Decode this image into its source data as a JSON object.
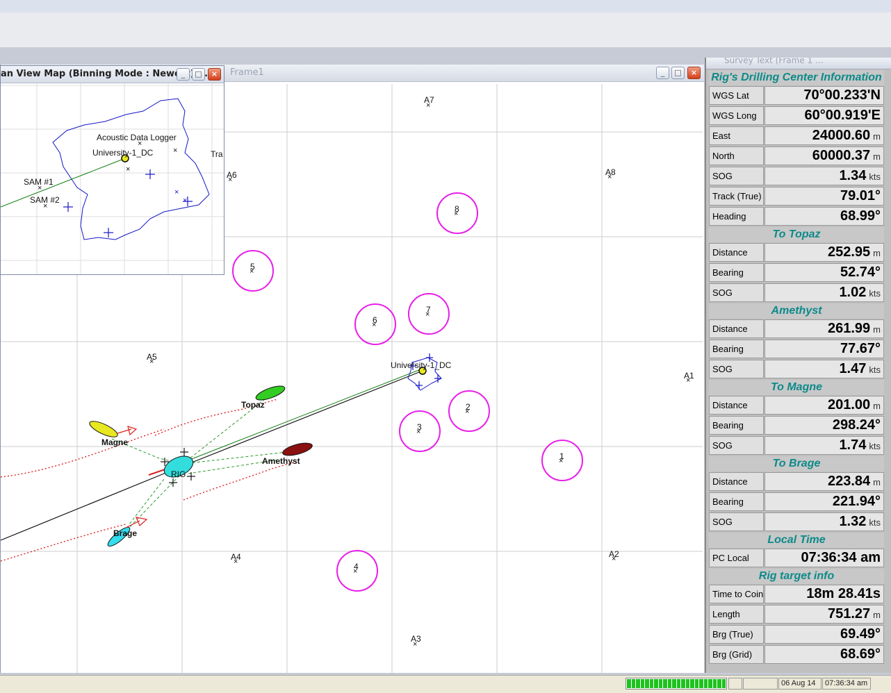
{
  "inset_window": {
    "title": "an View Map (Binning Mode : Newest) ...",
    "labels": {
      "adl": "Acoustic Data Logger",
      "univ": "University-1_DC",
      "sam1": "SAM #1",
      "sam2": "SAM #2",
      "tra": "Tra"
    }
  },
  "main_window": {
    "title": "Frame1"
  },
  "panel": {
    "title": "Survey Text (Frame 1 ...",
    "sections": [
      {
        "title": "Rig's Drilling Center Information",
        "rows": [
          {
            "label": "WGS Lat",
            "value": "70°00.233'N",
            "unit": ""
          },
          {
            "label": "WGS Long",
            "value": "60°00.919'E",
            "unit": ""
          },
          {
            "label": "East",
            "value": "24000.60",
            "unit": "m"
          },
          {
            "label": "North",
            "value": "60000.37",
            "unit": "m"
          },
          {
            "label": "SOG",
            "value": "1.34",
            "unit": "kts"
          },
          {
            "label": "Track (True)",
            "value": "79.01°",
            "unit": ""
          },
          {
            "label": "Heading",
            "value": "68.99°",
            "unit": ""
          }
        ]
      },
      {
        "title": "To Topaz",
        "rows": [
          {
            "label": "Distance",
            "value": "252.95",
            "unit": "m"
          },
          {
            "label": "Bearing",
            "value": "52.74°",
            "unit": ""
          },
          {
            "label": "SOG",
            "value": "1.02",
            "unit": "kts"
          }
        ]
      },
      {
        "title": "Amethyst",
        "rows": [
          {
            "label": "Distance",
            "value": "261.99",
            "unit": "m"
          },
          {
            "label": "Bearing",
            "value": "77.67°",
            "unit": ""
          },
          {
            "label": "SOG",
            "value": "1.47",
            "unit": "kts"
          }
        ]
      },
      {
        "title": "To Magne",
        "rows": [
          {
            "label": "Distance",
            "value": "201.00",
            "unit": "m"
          },
          {
            "label": "Bearing",
            "value": "298.24°",
            "unit": ""
          },
          {
            "label": "SOG",
            "value": "1.74",
            "unit": "kts"
          }
        ]
      },
      {
        "title": "To Brage",
        "rows": [
          {
            "label": "Distance",
            "value": "223.84",
            "unit": "m"
          },
          {
            "label": "Bearing",
            "value": "221.94°",
            "unit": ""
          },
          {
            "label": "SOG",
            "value": "1.32",
            "unit": "kts"
          }
        ]
      },
      {
        "title": "Local Time",
        "rows": [
          {
            "label": "PC Local",
            "value": "07:36:34 am",
            "unit": ""
          }
        ]
      },
      {
        "title": "Rig target info",
        "rows": [
          {
            "label": "Time to Coin",
            "value": "18m 28.41s",
            "unit": ""
          },
          {
            "label": "Length",
            "value": "751.27",
            "unit": "m"
          },
          {
            "label": "Brg (True)",
            "value": "69.49°",
            "unit": ""
          },
          {
            "label": "Brg (Grid)",
            "value": "68.69°",
            "unit": ""
          }
        ]
      }
    ]
  },
  "map": {
    "anchors": [
      "A1",
      "A2",
      "A3",
      "A4",
      "A5",
      "A6",
      "A7",
      "A8"
    ],
    "targets": [
      "1",
      "2",
      "3",
      "4",
      "5",
      "6",
      "7",
      "8"
    ],
    "vessels": [
      "Topaz",
      "Magne",
      "Amethyst",
      "Brage"
    ],
    "rig_label": "RIG",
    "center_label": "University-1_DC"
  },
  "status": {
    "date": "06 Aug 14",
    "time": "07:36:34 am",
    "progress_segments": 22
  },
  "colors": {
    "target_circle": "#e81ee8",
    "topaz": "#33cc22",
    "magne": "#e8e820",
    "amethyst": "#8b1010",
    "brage": "#33ddee",
    "rig": "#33dddd",
    "section_title": "#0d8a8a"
  }
}
